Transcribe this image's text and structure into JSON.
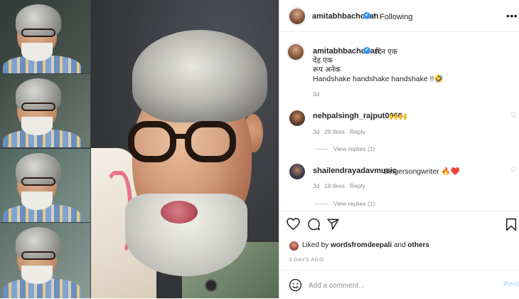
{
  "post": {
    "author": "amitabhbachchan",
    "follow_separator": "•",
    "follow_status": "Following",
    "more_icon": "•••",
    "verified_icon": "✓"
  },
  "caption": {
    "username": "amitabhbachchan",
    "inline_text": "दिन एक",
    "lines": [
      "देह एक",
      "रूप अनेक",
      "Handshake handshake handshake !!🤣"
    ],
    "time": "3d"
  },
  "comments": [
    {
      "username": "nehpalsingh_rajput0060",
      "text": "🙌🙌",
      "time": "3d",
      "likes": "28 likes",
      "reply_label": "Reply",
      "view_replies": "View replies (1)",
      "heart_icon": "♡"
    },
    {
      "username": "shailendrayadavmusic",
      "text": "Singersongwriter 🔥❤️",
      "time": "3d",
      "likes": "19 likes",
      "reply_label": "Reply",
      "view_replies": "View replies (1)",
      "heart_icon": "♡"
    }
  ],
  "actions": {
    "icons": [
      "heart-icon",
      "comment-icon",
      "share-icon",
      "bookmark-icon"
    ]
  },
  "likes": {
    "prefix": "Liked by",
    "user": "wordsfromdeepali",
    "conjunction": "and",
    "suffix": "others"
  },
  "date": "3 DAYS AGO",
  "add_comment": {
    "emoji_icon": "smiley-icon",
    "placeholder": "Add a comment...",
    "post_label": "Post"
  },
  "colors": {
    "verified": "#3897f0",
    "muted": "#8e8e8e",
    "post_disabled": "#b2dffc"
  }
}
